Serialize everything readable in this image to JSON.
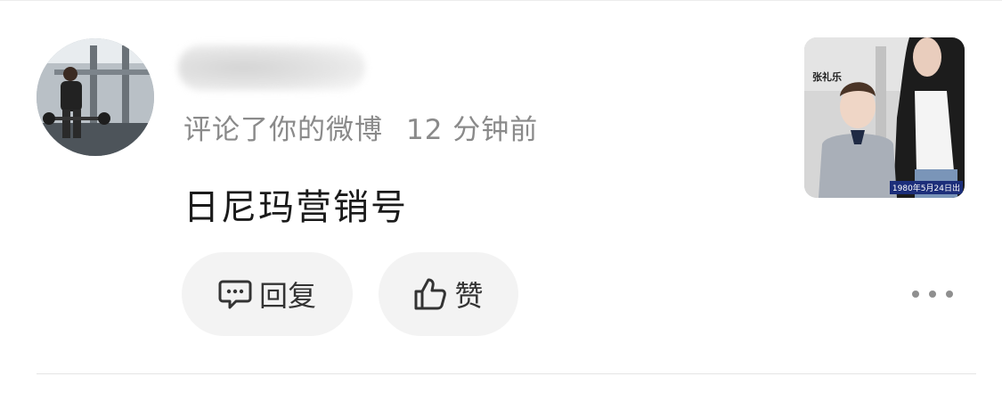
{
  "notification": {
    "action_text": "评论了你的微博",
    "time": "12 分钟前",
    "comment": "日尼玛营销号"
  },
  "thumbnail": {
    "overlay_name": "张礼乐",
    "overlay_date": "1980年5月24日出"
  },
  "actions": {
    "reply_label": "回复",
    "like_label": "赞"
  },
  "icons": {
    "reply": "comment-bubble-icon",
    "like": "thumbs-up-icon",
    "more": "more-horizontal-icon"
  }
}
